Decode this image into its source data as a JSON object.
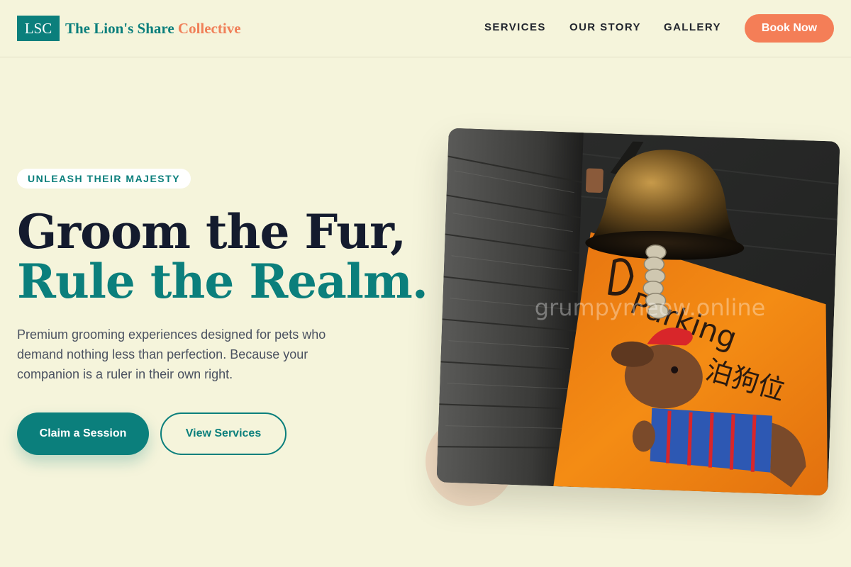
{
  "header": {
    "logo_mark": "LSC",
    "brand_primary": "The Lion's Share",
    "brand_accent": "Collective",
    "nav": [
      {
        "label": "SERVICES"
      },
      {
        "label": "OUR STORY"
      },
      {
        "label": "GALLERY"
      }
    ],
    "cta_label": "Book Now"
  },
  "hero": {
    "eyebrow": "UNLEASH THEIR MAJESTY",
    "headline_line1": "Groom the Fur,",
    "headline_line2": "Rule the Realm.",
    "lede": "Premium grooming experiences designed for pets who demand nothing less than perfection. Because your companion is a ruler in their own right.",
    "primary_cta": "Claim a Session",
    "secondary_cta": "View Services",
    "image": {
      "sign_text": "Dog Parking",
      "sign_text_cjk": "泊狗位",
      "watermark": "grumpymeow.online"
    }
  },
  "colors": {
    "background": "#f5f4db",
    "teal": "#0b7f7c",
    "coral": "#f47e57",
    "ink": "#141b2e",
    "body_text": "#4a5160"
  },
  "icons": {
    "logo": "lsc-logo-mark"
  }
}
